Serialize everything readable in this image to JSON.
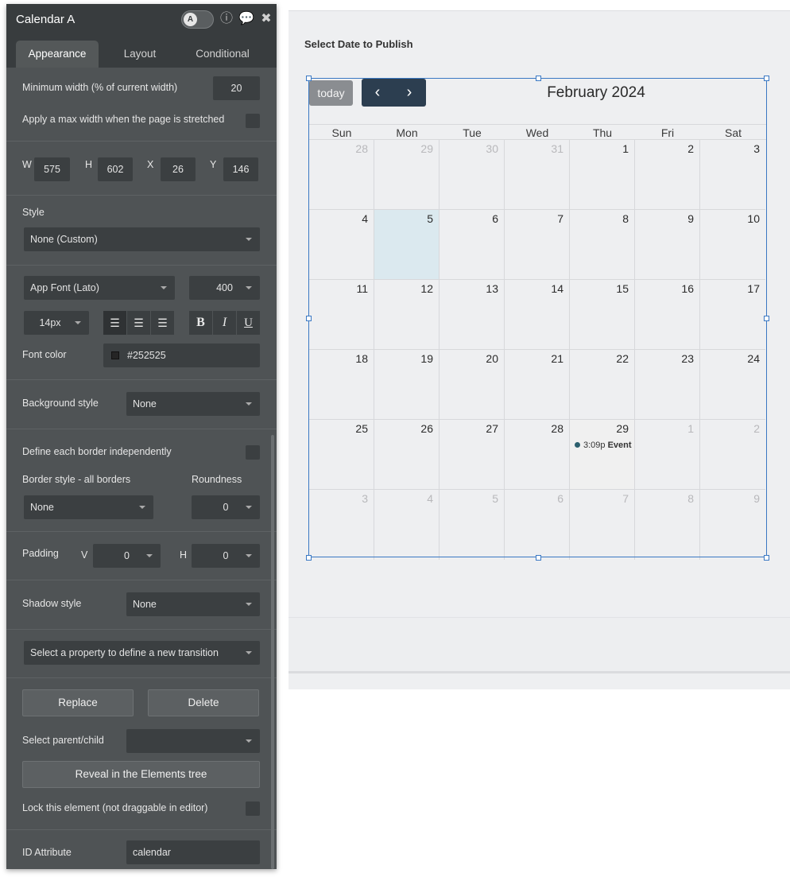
{
  "panel": {
    "title": "Calendar A",
    "tabs": [
      "Appearance",
      "Layout",
      "Conditional"
    ],
    "min_width_label": "Minimum width (% of current width)",
    "min_width_value": "20",
    "max_width_label": "Apply a max width when the page is stretched",
    "dims": {
      "w_label": "W",
      "w": "575",
      "h_label": "H",
      "h": "602",
      "x_label": "X",
      "x": "26",
      "y_label": "Y",
      "y": "146"
    },
    "style_label": "Style",
    "style_value": "None (Custom)",
    "font_family": "App Font (Lato)",
    "font_weight": "400",
    "font_size": "14px",
    "font_color_label": "Font color",
    "font_color_value": "#252525",
    "bg_style_label": "Background style",
    "bg_style_value": "None",
    "border_indep_label": "Define each border independently",
    "border_style_label": "Border style - all borders",
    "roundness_label": "Roundness",
    "border_style_value": "None",
    "roundness_value": "0",
    "padding_label": "Padding",
    "padding_v_label": "V",
    "padding_v": "0",
    "padding_h_label": "H",
    "padding_h": "0",
    "shadow_label": "Shadow style",
    "shadow_value": "None",
    "transition_placeholder": "Select a property to define a new transition",
    "replace_label": "Replace",
    "delete_label": "Delete",
    "parent_child_label": "Select parent/child",
    "reveal_label": "Reveal in the Elements tree",
    "lock_label": "Lock this element (not draggable in editor)",
    "id_attr_label": "ID Attribute",
    "id_attr_value": "calendar"
  },
  "canvas": {
    "heading": "Select Date to Publish"
  },
  "calendar": {
    "today_label": "today",
    "month_title": "February 2024",
    "weekdays": [
      "Sun",
      "Mon",
      "Tue",
      "Wed",
      "Thu",
      "Fri",
      "Sat"
    ],
    "weeks": [
      [
        {
          "d": "28",
          "o": true
        },
        {
          "d": "29",
          "o": true
        },
        {
          "d": "30",
          "o": true
        },
        {
          "d": "31",
          "o": true
        },
        {
          "d": "1"
        },
        {
          "d": "2"
        },
        {
          "d": "3"
        }
      ],
      [
        {
          "d": "4"
        },
        {
          "d": "5",
          "today": true
        },
        {
          "d": "6"
        },
        {
          "d": "7"
        },
        {
          "d": "8"
        },
        {
          "d": "9"
        },
        {
          "d": "10"
        }
      ],
      [
        {
          "d": "11"
        },
        {
          "d": "12"
        },
        {
          "d": "13"
        },
        {
          "d": "14"
        },
        {
          "d": "15"
        },
        {
          "d": "16"
        },
        {
          "d": "17"
        }
      ],
      [
        {
          "d": "18"
        },
        {
          "d": "19"
        },
        {
          "d": "20"
        },
        {
          "d": "21"
        },
        {
          "d": "22"
        },
        {
          "d": "23"
        },
        {
          "d": "24"
        }
      ],
      [
        {
          "d": "25"
        },
        {
          "d": "26"
        },
        {
          "d": "27"
        },
        {
          "d": "28"
        },
        {
          "d": "29",
          "event": {
            "time": "3:09p",
            "name": "Event"
          }
        },
        {
          "d": "1",
          "o": true
        },
        {
          "d": "2",
          "o": true
        }
      ],
      [
        {
          "d": "3",
          "o": true
        },
        {
          "d": "4",
          "o": true
        },
        {
          "d": "5",
          "o": true
        },
        {
          "d": "6",
          "o": true
        },
        {
          "d": "7",
          "o": true
        },
        {
          "d": "8",
          "o": true
        },
        {
          "d": "9",
          "o": true
        }
      ]
    ],
    "colors": {
      "nav_bg": "#2c3e50",
      "today_bg": "#dbe9ef",
      "event_dot": "#2c5f6e",
      "selection": "#3a78c3"
    }
  }
}
